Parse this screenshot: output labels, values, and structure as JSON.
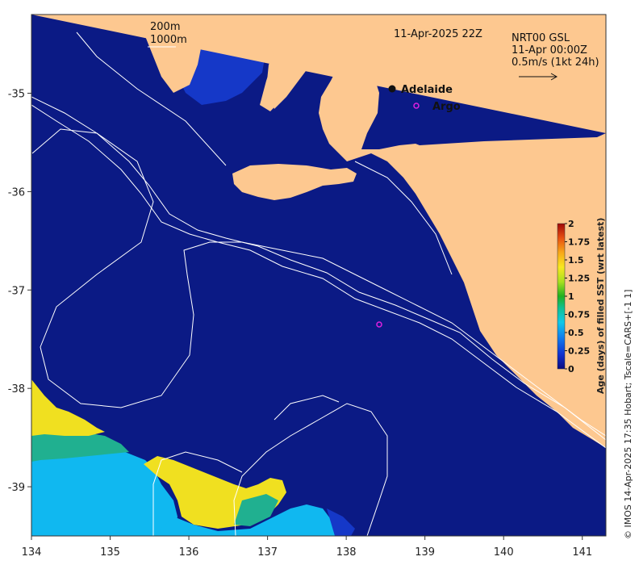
{
  "map": {
    "timestamp": "11-Apr-2025 22Z",
    "product_line1": "NRT00 GSL",
    "product_line2": "11-Apr 00:00Z",
    "scale_text": "0.5m/s (1kt 24h)",
    "legend_200m": "200m",
    "legend_1000m": "1000m",
    "place_adelaide": "Adelaide",
    "place_argo": "Argo",
    "credit": "© IMOS 14-Apr-2025 17:35 Hobart; Tscale=CARS+[-1 1]",
    "colors": {
      "ocean": "#0b1a85",
      "land": "#fdc890",
      "contour": "#ffffff",
      "argo": "#e020e0",
      "age_low": "#1538c8",
      "age_mid": "#0fc0f0",
      "age_green": "#20b080",
      "age_yellow": "#f0e020"
    }
  },
  "chart_data": {
    "type": "heatmap",
    "xlim": [
      134,
      141.3
    ],
    "ylim": [
      -39.5,
      -34.2
    ],
    "x_ticks": [
      134,
      135,
      136,
      137,
      138,
      139,
      140,
      141
    ],
    "y_ticks": [
      -35,
      -36,
      -37,
      -38,
      -39
    ],
    "x_tick_labels": [
      "134",
      "135",
      "136",
      "137",
      "138",
      "139",
      "140",
      "141"
    ],
    "y_tick_labels": [
      "-35",
      "-36",
      "-37",
      "-38",
      "-39"
    ],
    "points": [
      {
        "name": "Adelaide",
        "lon": 138.6,
        "lat": -34.93
      },
      {
        "name": "Argo",
        "lon": 138.9,
        "lat": -35.12
      },
      {
        "name": "Argo float",
        "lon": 138.42,
        "lat": -37.35
      }
    ],
    "colorbar": {
      "label": "Age (days) of filled SST (wrt latest)",
      "range": [
        0,
        2
      ],
      "ticks": [
        0,
        0.25,
        0.5,
        0.75,
        1,
        1.25,
        1.5,
        1.75,
        2
      ],
      "tick_labels": [
        "0",
        "0.25",
        "0.5",
        "0.75",
        "1",
        "1.25",
        "1.5",
        "1.75",
        "2"
      ]
    }
  }
}
